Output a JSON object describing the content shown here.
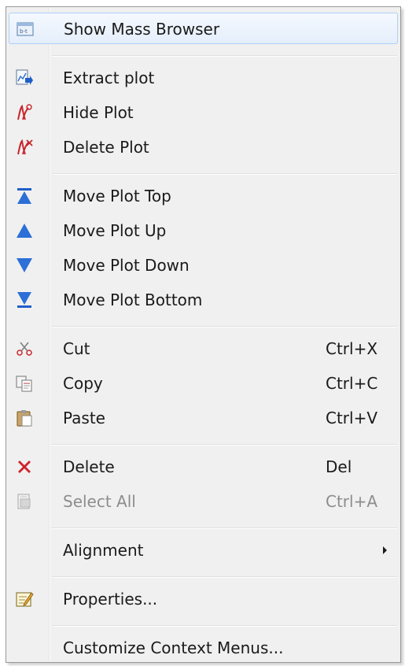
{
  "menu": {
    "items": [
      {
        "label": "Show Mass Browser",
        "shortcut": "",
        "icon": "mass-browser-icon",
        "highlighted": true
      },
      {
        "label": "Extract plot",
        "shortcut": "",
        "icon": "extract-plot-icon"
      },
      {
        "label": "Hide Plot",
        "shortcut": "",
        "icon": "hide-plot-icon"
      },
      {
        "label": "Delete Plot",
        "shortcut": "",
        "icon": "delete-plot-icon"
      },
      {
        "label": "Move Plot Top",
        "shortcut": "",
        "icon": "move-top-icon"
      },
      {
        "label": "Move Plot Up",
        "shortcut": "",
        "icon": "move-up-icon"
      },
      {
        "label": "Move Plot Down",
        "shortcut": "",
        "icon": "move-down-icon"
      },
      {
        "label": "Move Plot Bottom",
        "shortcut": "",
        "icon": "move-bottom-icon"
      },
      {
        "label": "Cut",
        "shortcut": "Ctrl+X",
        "icon": "scissors-icon"
      },
      {
        "label": "Copy",
        "shortcut": "Ctrl+C",
        "icon": "copy-icon"
      },
      {
        "label": "Paste",
        "shortcut": "Ctrl+V",
        "icon": "paste-icon"
      },
      {
        "label": "Delete",
        "shortcut": "Del",
        "icon": "delete-x-icon"
      },
      {
        "label": "Select All",
        "shortcut": "Ctrl+A",
        "icon": "select-all-icon",
        "disabled": true
      },
      {
        "label": "Alignment",
        "shortcut": "",
        "icon": "",
        "submenu": true
      },
      {
        "label": "Properties...",
        "shortcut": "",
        "icon": "properties-icon"
      },
      {
        "label": "Customize Context Menus...",
        "shortcut": "",
        "icon": ""
      }
    ]
  },
  "colors": {
    "highlight_border": "#aecff7",
    "disabled_text": "#8d8d8d",
    "arrow_blue": "#1f5fc8",
    "delete_red": "#d0222a"
  }
}
